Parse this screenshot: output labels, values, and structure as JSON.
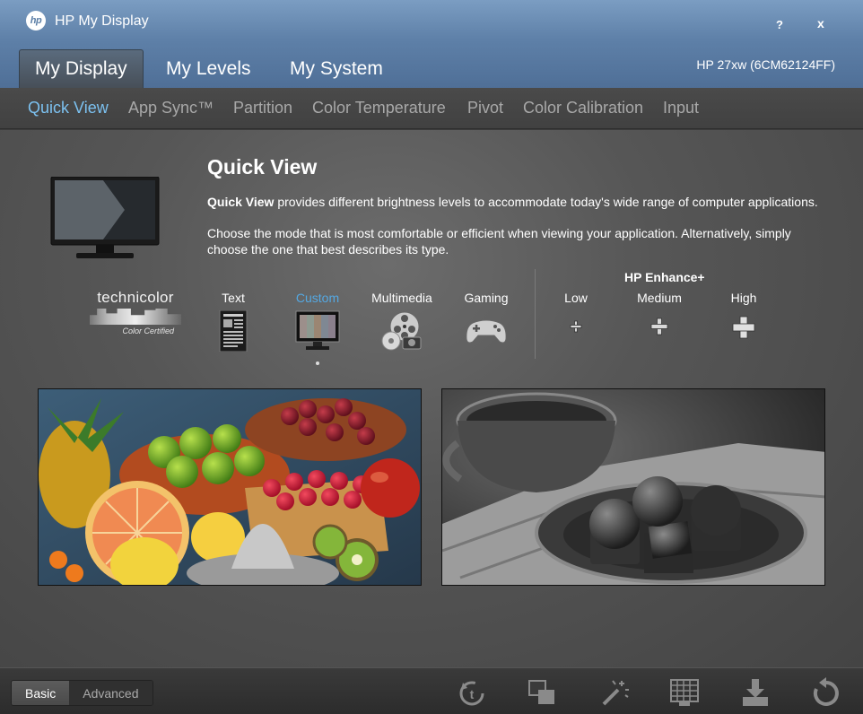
{
  "window": {
    "logo_text": "hp",
    "title": "HP My Display",
    "help_label": "?",
    "close_label": "x",
    "monitor_id": "HP 27xw (6CM62124FF)"
  },
  "main_tabs": [
    {
      "label": "My Display",
      "active": true
    },
    {
      "label": "My Levels",
      "active": false
    },
    {
      "label": "My System",
      "active": false
    }
  ],
  "sub_tabs": [
    {
      "label": "Quick View",
      "active": true
    },
    {
      "label": "App Sync™",
      "active": false
    },
    {
      "label": "Partition",
      "active": false
    },
    {
      "label": "Color Temperature",
      "active": false
    },
    {
      "label": "Pivot",
      "active": false
    },
    {
      "label": "Color Calibration",
      "active": false
    },
    {
      "label": "Input",
      "active": false
    }
  ],
  "quick_view": {
    "title": "Quick View",
    "desc1_bold": "Quick View",
    "desc1_rest": " provides different brightness levels to accommodate today's wide range of computer applications.",
    "desc2": "Choose the mode that is most comfortable or efficient when viewing your application. Alternatively, simply choose the one that best describes its type."
  },
  "technicolor": {
    "name": "technicolor",
    "sub": "Color Certified"
  },
  "modes": [
    {
      "label": "Text",
      "icon": "text-document-icon",
      "selected": false
    },
    {
      "label": "Custom",
      "icon": "custom-monitor-icon",
      "selected": true
    },
    {
      "label": "Multimedia",
      "icon": "film-reel-icon",
      "selected": false
    },
    {
      "label": "Gaming",
      "icon": "gamepad-icon",
      "selected": false
    }
  ],
  "enhance": {
    "title": "HP Enhance+",
    "levels": [
      {
        "label": "Low"
      },
      {
        "label": "Medium"
      },
      {
        "label": "High"
      }
    ]
  },
  "bottom": {
    "basic_label": "Basic",
    "advanced_label": "Advanced",
    "tools": [
      "timer-icon",
      "window-layers-icon",
      "magic-wand-icon",
      "grid-display-icon",
      "download-icon",
      "reset-icon"
    ]
  },
  "colors": {
    "accent_blue": "#7cc1f0",
    "selected_mode": "#54a8e2",
    "titlebar": "#5e80a8"
  }
}
